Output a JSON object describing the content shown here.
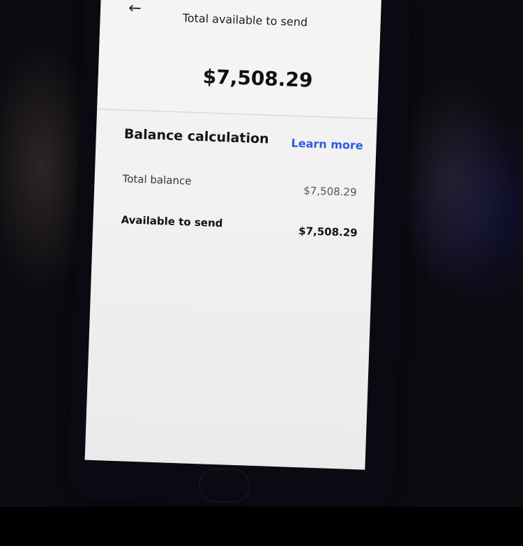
{
  "header": {
    "back_icon": "←",
    "title": "Total available to send"
  },
  "summary": {
    "amount": "$7,508.29"
  },
  "balance_section": {
    "title": "Balance calculation",
    "learn_more": "Learn more",
    "rows": [
      {
        "label": "Total balance",
        "value": "$7,508.29"
      },
      {
        "label": "Available to send",
        "value": "$7,508.29"
      }
    ]
  },
  "colors": {
    "link": "#2d5be3",
    "screen_bg": "#f2f2f2"
  }
}
